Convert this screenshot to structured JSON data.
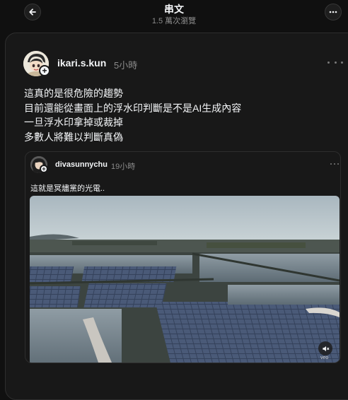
{
  "header": {
    "title": "串文",
    "views": "1.5 萬次瀏覽",
    "back_icon": "arrow-left-icon",
    "more_icon": "more-horizontal-icon"
  },
  "post": {
    "username": "ikari.s.kun",
    "time": "5小時",
    "lines": [
      "這真的是很危險的趨勢",
      "目前還能從畫面上的浮水印判斷是不是AI生成內容",
      "一旦浮水印拿掉或裁掉",
      "多數人將難以判斷真偽"
    ]
  },
  "quoted": {
    "username": "divasunnychu",
    "time": "19小時",
    "text": "這就是冥燼黨的光電..",
    "watermark": "veo",
    "mute_icon": "speaker-muted-icon"
  },
  "colors": {
    "background": "#101010",
    "card": "#181818",
    "border": "#2e2e2e",
    "muted_text": "#8a8a8a",
    "primary_text": "#f3f5f7"
  }
}
